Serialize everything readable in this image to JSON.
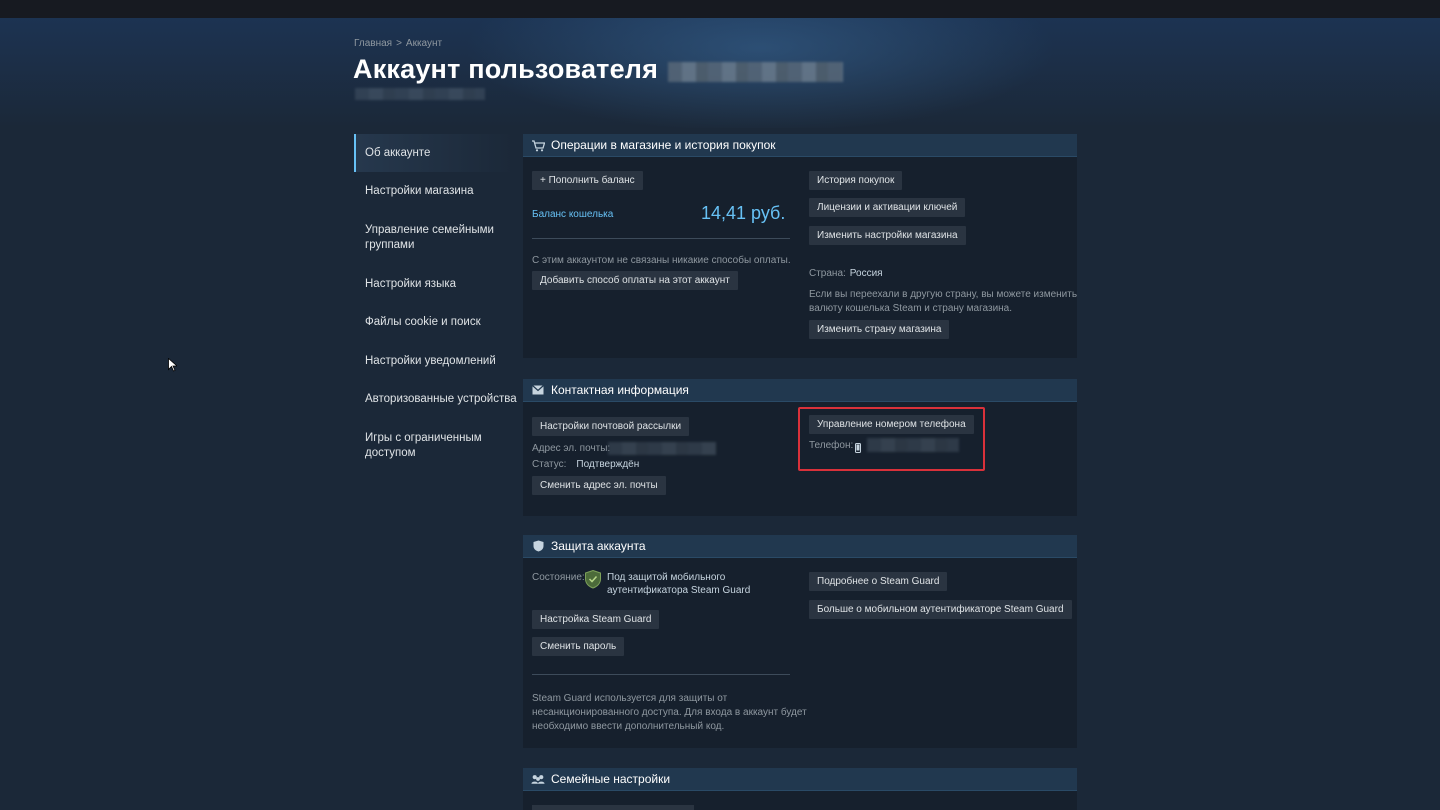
{
  "breadcrumb": {
    "home": "Главная",
    "sep": ">",
    "current": "Аккаунт"
  },
  "page_title": "Аккаунт пользователя",
  "sidebar": {
    "items": [
      {
        "label": "Об аккаунте",
        "active": true
      },
      {
        "label": "Настройки магазина"
      },
      {
        "label": "Управление семейными группами"
      },
      {
        "label": "Настройки языка"
      },
      {
        "label": "Файлы cookie и поиск"
      },
      {
        "label": "Настройки уведомлений"
      },
      {
        "label": "Авторизованные устройства"
      },
      {
        "label": "Игры с ограниченным доступом"
      }
    ]
  },
  "store": {
    "title": "Операции в магазине и история покупок",
    "add_funds": "+ Пополнить баланс",
    "wallet_label": "Баланс кошелька",
    "wallet_value": "14,41 руб.",
    "no_payment": "С этим аккаунтом не связаны никакие способы оплаты.",
    "add_payment": "Добавить способ оплаты на этот аккаунт",
    "purchase_history": "История покупок",
    "licenses": "Лицензии и активации ключей",
    "store_prefs": "Изменить настройки магазина",
    "country_label": "Страна:",
    "country_value": "Россия",
    "moved_note_1": "Если вы переехали в другую страну, вы можете изменить",
    "moved_note_2": "валюту кошелька Steam и страну магазина.",
    "change_country": "Изменить страну магазина"
  },
  "contact": {
    "title": "Контактная информация",
    "email_prefs": "Настройки почтовой рассылки",
    "email_label": "Адрес эл. почты:",
    "status_label": "Статус:",
    "status_value": "Подтверждён",
    "change_email": "Сменить адрес эл. почты",
    "manage_phone": "Управление номером телефона",
    "phone_label": "Телефон:"
  },
  "security": {
    "title": "Защита аккаунта",
    "state_label": "Состояние:",
    "state_line1": "Под защитой мобильного",
    "state_line2": "аутентификатора Steam Guard",
    "guard_settings": "Настройка Steam Guard",
    "change_password": "Сменить пароль",
    "note_1": "Steam Guard используется для защиты от",
    "note_2": "несанкционированного доступа. Для входа в аккаунт будет",
    "note_3": "необходимо ввести дополнительный код.",
    "learn_guard": "Подробнее о Steam Guard",
    "learn_mobile": "Больше о мобильном аутентификаторе Steam Guard"
  },
  "family": {
    "title": "Семейные настройки"
  },
  "colors": {
    "accent": "#67c1f5",
    "background": "#1b2838",
    "highlight": "#d9313a"
  }
}
